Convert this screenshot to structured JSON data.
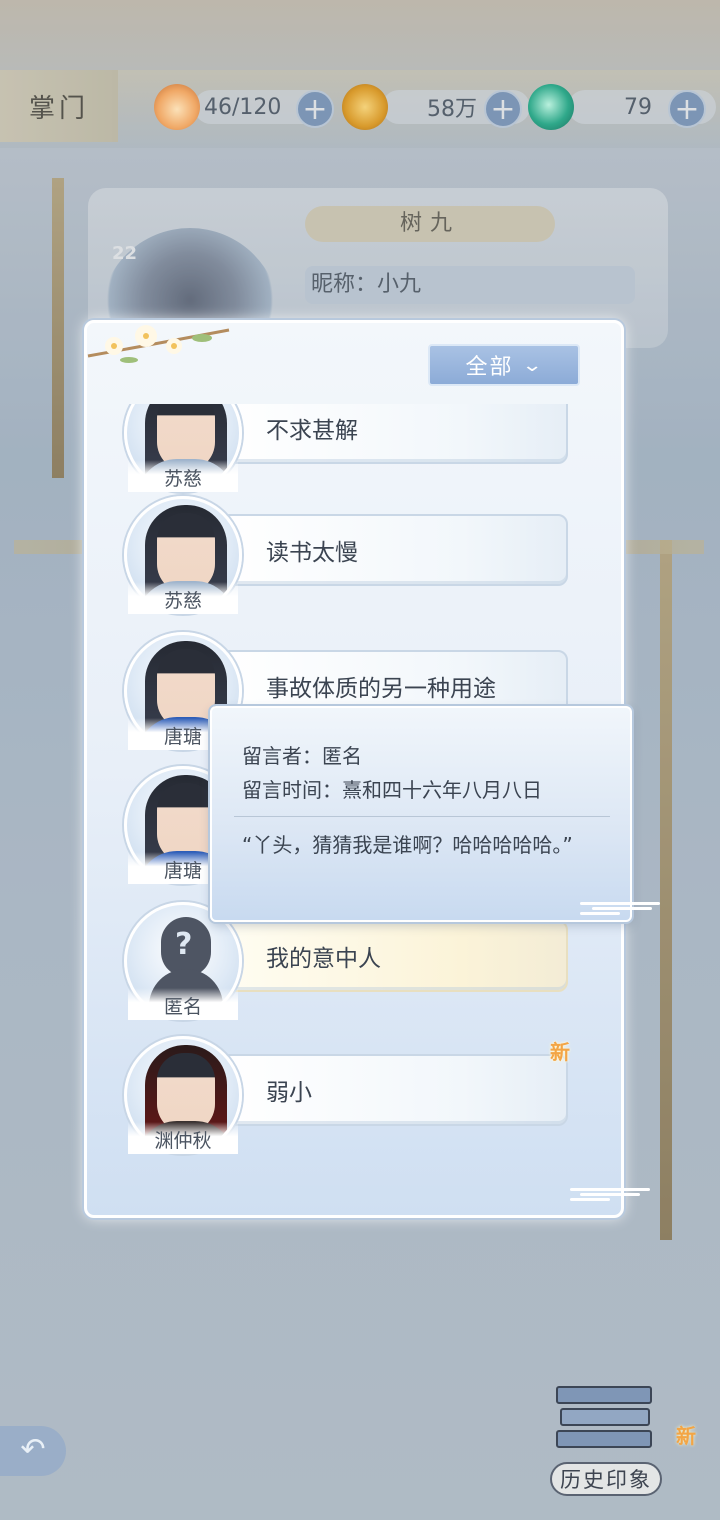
{
  "topbar": {
    "section_title": "掌门",
    "stamina": "46/120",
    "coins": "58万",
    "jade": "79"
  },
  "background_card": {
    "name": "树九",
    "nickname": "昵称：小九",
    "level": "22"
  },
  "panel": {
    "filter_label": "全部",
    "messages": [
      {
        "author": "苏慈",
        "text": "不求甚解"
      },
      {
        "author": "苏慈",
        "text": "读书太慢"
      },
      {
        "author": "唐瑭",
        "text": "事故体质的另一种用途"
      },
      {
        "author": "唐瑭",
        "text": ""
      },
      {
        "author": "匿名",
        "text": "我的意中人"
      },
      {
        "author": "渊仲秋",
        "text": "弱小",
        "badge": "新"
      }
    ]
  },
  "tooltip": {
    "author_line": "留言者：匿名",
    "time_line": "留言时间：熹和四十六年八月八日",
    "message": "“丫头，猜猜我是谁啊？哈哈哈哈哈。”"
  },
  "bottom": {
    "history_label": "历史印象",
    "history_badge": "新"
  }
}
